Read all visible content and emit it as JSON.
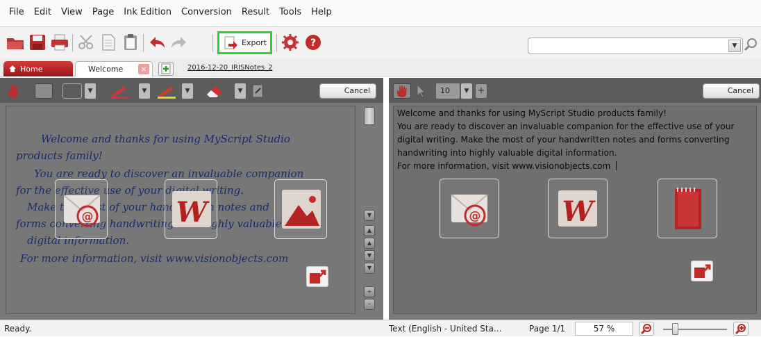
{
  "menu": [
    "File",
    "Edit",
    "View",
    "Page",
    "Ink Edition",
    "Conversion",
    "Result",
    "Tools",
    "Help"
  ],
  "toolbar": {
    "export_label": "Export",
    "search_placeholder": ""
  },
  "tabs": {
    "home": "Home",
    "welcome": "Welcome",
    "document": "2016-12-20_IRISNotes_2"
  },
  "left_panel": {
    "cancel_label": "Cancel",
    "handwriting": [
      "Welcome and thanks for using MyScript Studio",
      "products family!",
      "You are ready to discover an invaluable companion",
      "for the effective use of your digital writing.",
      "Make the most of your handwritten notes and",
      "forms converting handwriting into highly valuable",
      "digital information.",
      "For more information, visit www.visionobjects.com"
    ]
  },
  "right_panel": {
    "cancel_label": "Cancel",
    "font_size": "10",
    "recognized_text": [
      "Welcome and thanks for using MyScript Studio products family!",
      "You are ready to discover an invaluable companion for the effective use of your",
      "digital writing. Make the most of your handwritten notes and forms converting",
      "handwriting into highly valuable digital information.",
      "For more information, visit www.visionobjects.com"
    ]
  },
  "status": {
    "ready": "Ready.",
    "language": "Text (English - United Sta...",
    "page": "Page 1/1",
    "zoom": "57 %",
    "zoom_level": 0.57
  },
  "colors": {
    "accent_red": "#b32020",
    "export_highlight": "#2dd12d",
    "handwriting_ink": "#1b2a6b"
  }
}
